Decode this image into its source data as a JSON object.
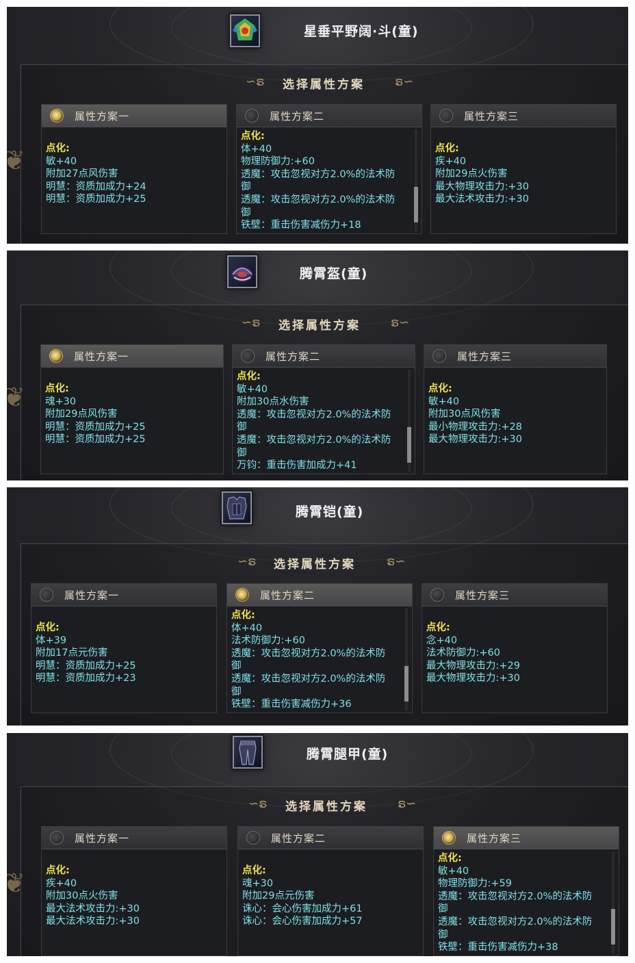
{
  "section_title": "选择属性方案",
  "panels": [
    {
      "item_name": "星垂平野阔·斗(童)",
      "item_icon": "hat-helmet-icon",
      "plans": [
        {
          "label": "属性方案一",
          "selected": true,
          "attr_title": "点化:",
          "lines": [
            "敏+40",
            "附加27点风伤害",
            "明慧：资质加成力+24",
            "明慧：资质加成力+25"
          ]
        },
        {
          "label": "属性方案二",
          "selected": false,
          "attr_title": "点化:",
          "lines": [
            "体+40",
            "物理防御力:+60",
            "透魔：攻击忽视对方2.0%的法术防",
            "御",
            "透魔：攻击忽视对方2.0%的法术防",
            "御",
            "铁壁：重击伤害减伤力+18"
          ]
        },
        {
          "label": "属性方案三",
          "selected": false,
          "attr_title": "点化:",
          "lines": [
            "疾+40",
            "附加29点火伤害",
            "最大物理攻击力:+30",
            "最大法术攻击力:+30"
          ]
        }
      ]
    },
    {
      "item_name": "腾霄盔(童)",
      "item_icon": "helmet-icon",
      "plans": [
        {
          "label": "属性方案一",
          "selected": true,
          "attr_title": "点化:",
          "lines": [
            "魂+30",
            "附加29点风伤害",
            "明慧：资质加成力+25",
            "明慧：资质加成力+25"
          ]
        },
        {
          "label": "属性方案二",
          "selected": false,
          "attr_title": "点化:",
          "lines": [
            "敏+40",
            "附加30点水伤害",
            "透魔：攻击忽视对方2.0%的法术防",
            "御",
            "透魔：攻击忽视对方2.0%的法术防",
            "御",
            "万钧：重击伤害加成力+41"
          ]
        },
        {
          "label": "属性方案三",
          "selected": false,
          "attr_title": "点化:",
          "lines": [
            "敏+40",
            "附加30点风伤害",
            "最小物理攻击力:+28",
            "最大物理攻击力:+30"
          ]
        }
      ]
    },
    {
      "item_name": "腾霄铠(童)",
      "item_icon": "armor-icon",
      "plans": [
        {
          "label": "属性方案一",
          "selected": false,
          "attr_title": "点化:",
          "lines": [
            "体+39",
            "附加17点元伤害",
            "明慧：资质加成力+25",
            "明慧：资质加成力+23"
          ]
        },
        {
          "label": "属性方案二",
          "selected": true,
          "attr_title": "点化:",
          "lines": [
            "体+40",
            "法术防御力:+60",
            "透魔：攻击忽视对方2.0%的法术防",
            "御",
            "透魔：攻击忽视对方2.0%的法术防",
            "御",
            "铁壁：重击伤害减伤力+36"
          ]
        },
        {
          "label": "属性方案三",
          "selected": false,
          "attr_title": "点化:",
          "lines": [
            "念+40",
            "法术防御力:+60",
            "最大物理攻击力:+29",
            "最大物理攻击力:+30"
          ]
        }
      ]
    },
    {
      "item_name": "腾霄腿甲(童)",
      "item_icon": "leg-armor-icon",
      "plans": [
        {
          "label": "属性方案一",
          "selected": false,
          "attr_title": "点化:",
          "lines": [
            "疾+40",
            "附加30点火伤害",
            "最大法术攻击力:+30",
            "最大法术攻击力:+30"
          ]
        },
        {
          "label": "属性方案二",
          "selected": false,
          "attr_title": "点化:",
          "lines": [
            "魂+30",
            "附加29点元伤害",
            "诛心：会心伤害加成力+61",
            "诛心：会心伤害加成力+57"
          ]
        },
        {
          "label": "属性方案三",
          "selected": true,
          "attr_title": "点化:",
          "lines": [
            "敏+40",
            "物理防御力:+59",
            "透魔：攻击忽视对方2.0%的法术防",
            "御",
            "透魔：攻击忽视对方2.0%的法术防",
            "御",
            "铁壁：重击伤害减伤力+38"
          ]
        }
      ]
    }
  ]
}
